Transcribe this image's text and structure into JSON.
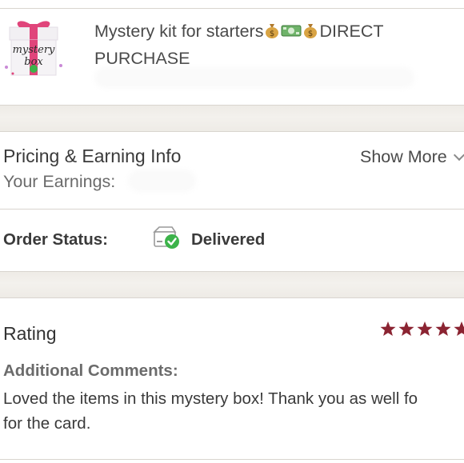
{
  "product": {
    "title": "Mystery kit for starters",
    "title_suffix": "DIRECT",
    "title_line2": "PURCHASE",
    "thumb_text": "mystery box",
    "thumb_icon": "gift-box-icon"
  },
  "pricing": {
    "heading": "Pricing & Earning Info",
    "show_more": "Show More",
    "earnings_label": "Your Earnings:"
  },
  "order": {
    "label": "Order Status:",
    "status": "Delivered",
    "status_icon": "package-delivered-icon",
    "status_color": "#3cb34a"
  },
  "rating": {
    "heading": "Rating",
    "stars": 5,
    "star_color": "#8b2432",
    "comments_label": "Additional Comments:",
    "comment_line1": "Loved the items in this mystery box! Thank you as well fo",
    "comment_line2": "for the card."
  }
}
